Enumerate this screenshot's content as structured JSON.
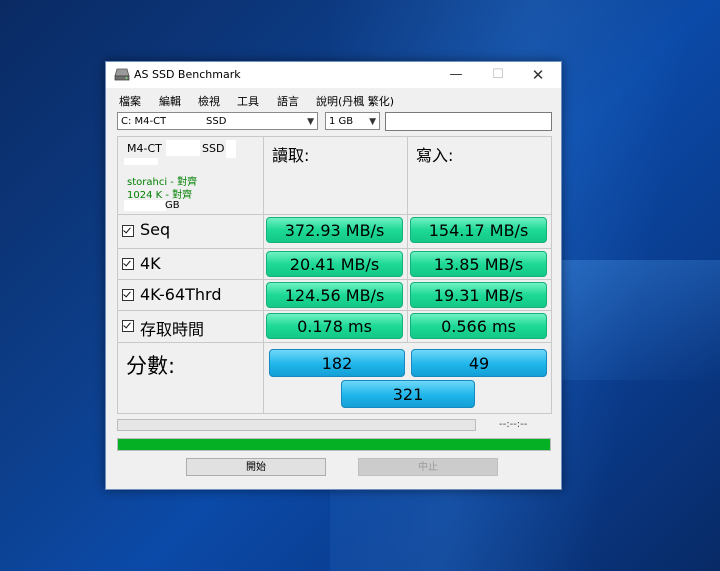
{
  "window": {
    "title": "AS SSD Benchmark"
  },
  "menu": [
    "檔案",
    "編輯",
    "檢視",
    "工具",
    "語言",
    "說明(丹楓 繁化)"
  ],
  "drive_select": {
    "value": "C: M4-CT",
    "suffix": "SSD"
  },
  "size_select": {
    "value": "1 GB"
  },
  "info": {
    "model": "M4-CT",
    "model_suffix": "SSD",
    "driver": "storahci - 對齊",
    "alignment": "1024 K - 對齊",
    "capacity_unit": "GB"
  },
  "headers": {
    "read": "讀取:",
    "write": "寫入:"
  },
  "rows": [
    {
      "label": "Seq",
      "read": "372.93 MB/s",
      "write": "154.17 MB/s"
    },
    {
      "label": "4K",
      "read": "20.41 MB/s",
      "write": "13.85 MB/s"
    },
    {
      "label": "4K-64Thrd",
      "read": "124.56 MB/s",
      "write": "19.31 MB/s"
    },
    {
      "label": "存取時間",
      "read": "0.178 ms",
      "write": "0.566 ms"
    }
  ],
  "score": {
    "label": "分數:",
    "read": "182",
    "write": "49",
    "total": "321"
  },
  "progress": {
    "time": "--:--:--",
    "overall_fraction": 1.0
  },
  "buttons": {
    "start": "開始",
    "stop": "中止"
  },
  "colors": {
    "result_green": "#1ed996",
    "score_blue": "#1fb5ea",
    "progress_green": "#06b025"
  }
}
